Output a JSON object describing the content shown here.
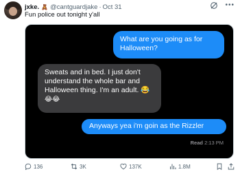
{
  "tweet": {
    "display_name": "jxke.",
    "badge": "🧸",
    "handle": "@cantguardjake",
    "separator": "·",
    "date": "Oct 31",
    "text": "Fun police out tonight y'all"
  },
  "header_icons": [
    "grok-icon",
    "more-icon"
  ],
  "media": {
    "messages": [
      {
        "side": "sent",
        "lines": [
          "What are you going as for",
          "Halloween?"
        ]
      },
      {
        "side": "received",
        "lines": [
          "Sweats and in bed. I just don't",
          "understand the whole bar and",
          "Halloween thing. I'm an adult. 😂",
          "😂😂"
        ]
      },
      {
        "side": "sent",
        "lines": [
          "Anyways yea i'm goin as the Rizzler"
        ]
      }
    ],
    "read_receipt": {
      "label": "Read",
      "time": "2:13 PM"
    },
    "colors": {
      "sent": "#1d8cf8",
      "received": "#3b3b3d",
      "background": "#000000"
    }
  },
  "actions": {
    "replies": "136",
    "retweets": "3K",
    "likes": "137K",
    "views": "1.8M"
  },
  "action_icons": [
    "reply-icon",
    "retweet-icon",
    "like-icon",
    "views-icon",
    "bookmark-icon",
    "share-icon"
  ]
}
